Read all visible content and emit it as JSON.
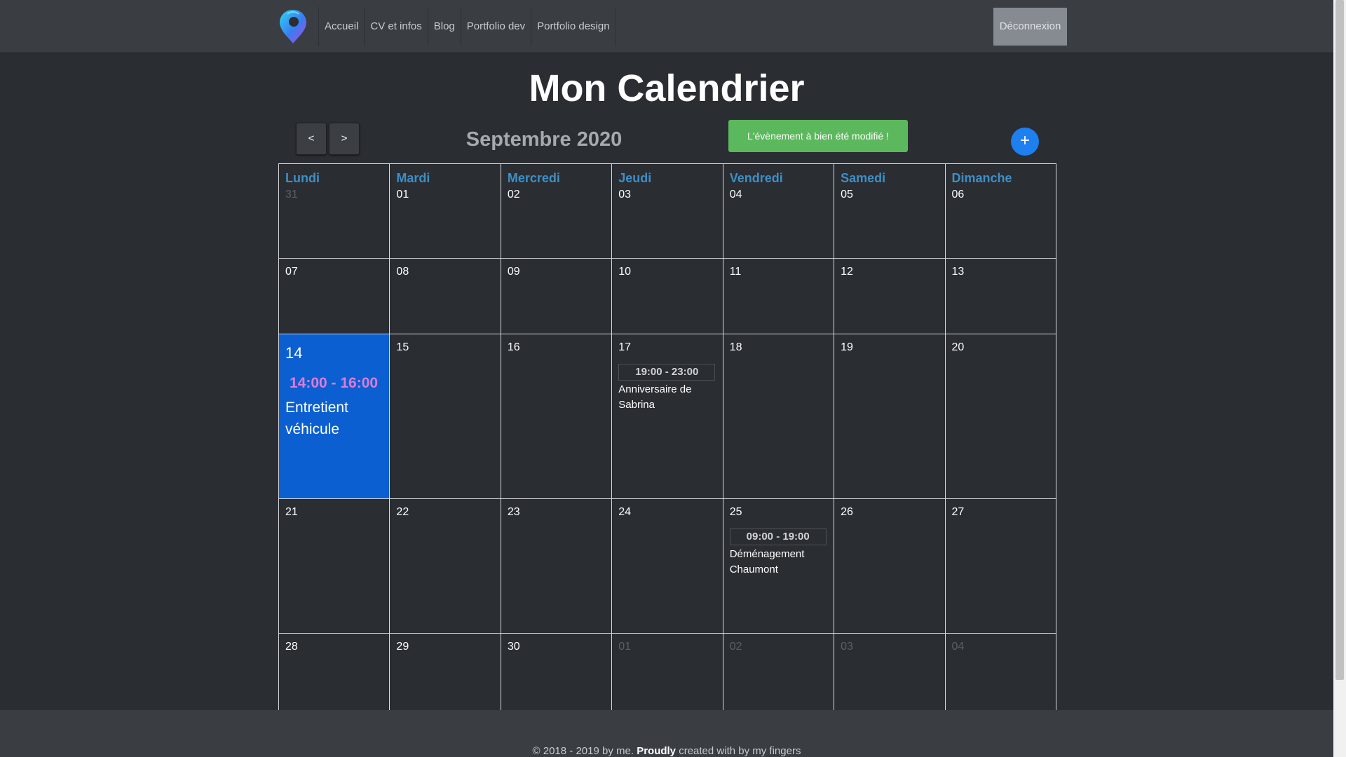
{
  "nav": {
    "logo": "map-pin-logo-icon",
    "links": [
      "Accueil",
      "CV et infos",
      "Blog",
      "Portfolio dev",
      "Portfolio design"
    ],
    "logout": "Déconnexion"
  },
  "page_title": "Mon Calendrier",
  "month_label": "Septembre 2020",
  "controls": {
    "prev": "<",
    "next": ">",
    "add": "+"
  },
  "alert": "L'évènement à bien été modifié !",
  "weekdays": [
    "Lundi",
    "Mardi",
    "Mercredi",
    "Jeudi",
    "Vendredi",
    "Samedi",
    "Dimanche"
  ],
  "weeks": [
    [
      "31",
      "01",
      "02",
      "03",
      "04",
      "05",
      "06"
    ],
    [
      "07",
      "08",
      "09",
      "10",
      "11",
      "12",
      "13"
    ],
    [
      "14",
      "15",
      "16",
      "17",
      "18",
      "19",
      "20"
    ],
    [
      "21",
      "22",
      "23",
      "24",
      "25",
      "26",
      "27"
    ],
    [
      "28",
      "29",
      "30",
      "01",
      "02",
      "03",
      "04"
    ]
  ],
  "events": {
    "today": {
      "time": "14:00 - 16:00",
      "title": "Entretient véhicule"
    },
    "sep17": {
      "time": "19:00 - 23:00",
      "title": "Anniversaire de Sabrina"
    },
    "sep25": {
      "time": "09:00 - 19:00",
      "title": "Déménagement Chaumont"
    }
  },
  "footer": {
    "prefix": "© 2018 - 2019 by me.",
    "bold": "Proudly",
    "suffix": "created with by my fingers"
  },
  "colors": {
    "background": "#2a2d32",
    "navbar": "#3a3d42",
    "weekday": "#3d8fc7",
    "today": "#0b5fd0",
    "today_time": "#e07ad8",
    "alert": "#5cb85c",
    "add_button": "#1e7ff0"
  }
}
